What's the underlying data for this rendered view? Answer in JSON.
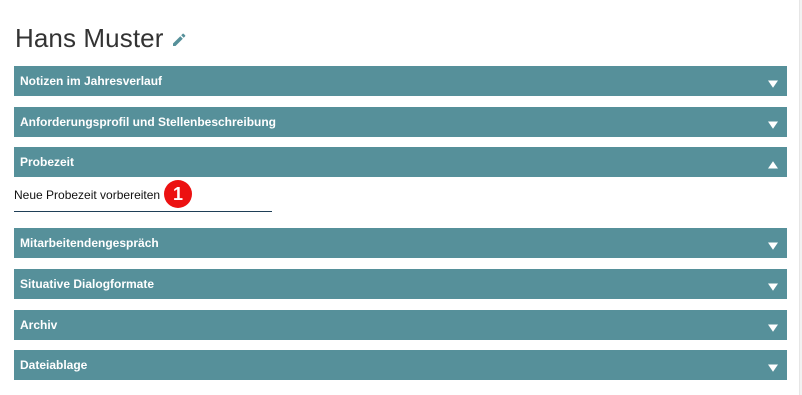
{
  "header": {
    "title": "Hans Muster",
    "edit_icon": "pencil-icon"
  },
  "accordions": [
    {
      "label": "Notizen im Jahresverlauf",
      "expanded": false,
      "toggle_icon": "triangle-down-icon"
    },
    {
      "label": "Anforderungsprofil und Stellenbeschreibung",
      "expanded": false,
      "toggle_icon": "triangle-down-icon"
    },
    {
      "label": "Probezeit",
      "expanded": true,
      "toggle_icon": "triangle-up-icon"
    },
    {
      "label": "Mitarbeitendengespräch",
      "expanded": false,
      "toggle_icon": "triangle-down-icon"
    },
    {
      "label": "Situative Dialogformate",
      "expanded": false,
      "toggle_icon": "triangle-down-icon"
    },
    {
      "label": "Archiv",
      "expanded": false,
      "toggle_icon": "triangle-down-icon"
    },
    {
      "label": "Dateiablage",
      "expanded": false,
      "toggle_icon": "triangle-down-icon"
    }
  ],
  "probezeit_panel": {
    "item_label": "Neue Probezeit vorbereiten",
    "badge": "1"
  },
  "colors": {
    "accordion_bg": "#56909a",
    "accordion_text": "#ffffff",
    "badge_bg": "#ec1111",
    "underline": "#1f3f57",
    "title_text": "#333333"
  }
}
